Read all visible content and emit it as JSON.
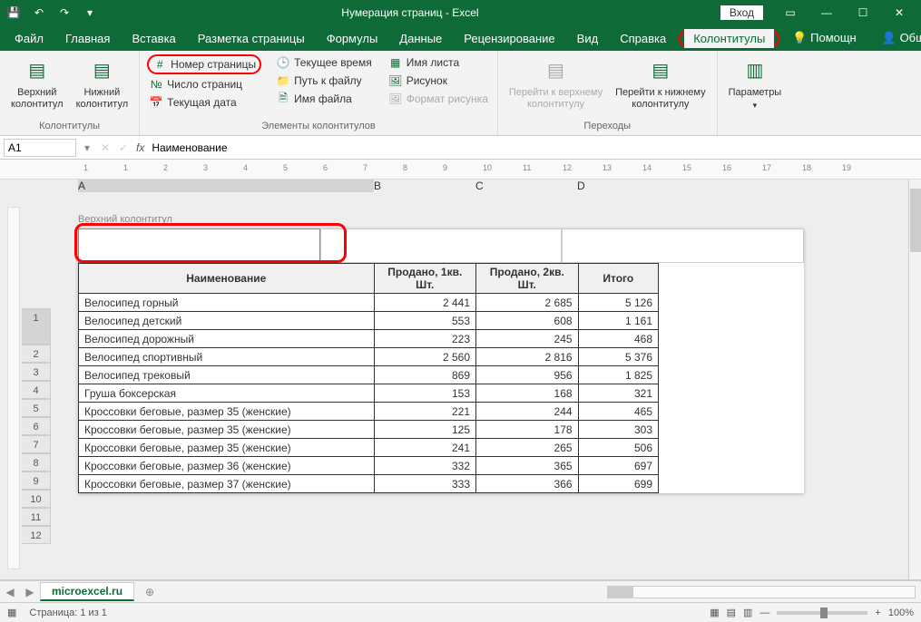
{
  "titlebar": {
    "title": "Нумерация страниц - Excel",
    "login": "Вход"
  },
  "tabs": {
    "file": "Файл",
    "home": "Главная",
    "insert": "Вставка",
    "pagelayout": "Разметка страницы",
    "formulas": "Формулы",
    "data": "Данные",
    "review": "Рецензирование",
    "view": "Вид",
    "help": "Справка",
    "headfoot": "Колонтитулы",
    "tell": "Помощн",
    "share": "Общий доступ"
  },
  "ribbon": {
    "g1": {
      "label": "Колонтитулы",
      "top": "Верхний\nколонтитул",
      "bottom": "Нижний\nколонтитул"
    },
    "g2": {
      "label": "Элементы колонтитулов",
      "pagenum": "Номер страницы",
      "pagecount": "Число страниц",
      "curdate": "Текущая дата",
      "curtime": "Текущее время",
      "filepath": "Путь к файлу",
      "filename": "Имя файла",
      "sheetname": "Имя листа",
      "picture": "Рисунок",
      "fmtpicture": "Формат рисунка"
    },
    "g3": {
      "label": "Переходы",
      "gotop": "Перейти к верхнему\nколонтитулу",
      "gobottom": "Перейти к нижнему\nколонтитулу"
    },
    "g4": {
      "label": "",
      "options": "Параметры"
    }
  },
  "formula": {
    "cellref": "A1",
    "value": "Наименование"
  },
  "colheads": {
    "A": "A",
    "B": "B",
    "C": "C",
    "D": "D"
  },
  "header_label": "Верхний колонтитул",
  "table": {
    "headers": {
      "name": "Наименование",
      "q1": "Продано, 1кв. Шт.",
      "q2": "Продано, 2кв. Шт.",
      "total": "Итого"
    },
    "rows": [
      {
        "name": "Велосипед горный",
        "q1": "2 441",
        "q2": "2 685",
        "total": "5 126"
      },
      {
        "name": "Велосипед детский",
        "q1": "553",
        "q2": "608",
        "total": "1 161"
      },
      {
        "name": "Велосипед дорожный",
        "q1": "223",
        "q2": "245",
        "total": "468"
      },
      {
        "name": "Велосипед спортивный",
        "q1": "2 560",
        "q2": "2 816",
        "total": "5 376"
      },
      {
        "name": "Велосипед трековый",
        "q1": "869",
        "q2": "956",
        "total": "1 825"
      },
      {
        "name": "Груша боксерская",
        "q1": "153",
        "q2": "168",
        "total": "321"
      },
      {
        "name": "Кроссовки беговые, размер 35 (женские)",
        "q1": "221",
        "q2": "244",
        "total": "465"
      },
      {
        "name": "Кроссовки беговые, размер 35 (женские)",
        "q1": "125",
        "q2": "178",
        "total": "303"
      },
      {
        "name": "Кроссовки беговые, размер 35 (женские)",
        "q1": "241",
        "q2": "265",
        "total": "506"
      },
      {
        "name": "Кроссовки беговые, размер 36 (женские)",
        "q1": "332",
        "q2": "365",
        "total": "697"
      },
      {
        "name": "Кроссовки беговые, размер 37 (женские)",
        "q1": "333",
        "q2": "366",
        "total": "699"
      }
    ]
  },
  "sheettab": "microexcel.ru",
  "status": {
    "page": "Страница: 1 из 1",
    "zoom": "100%"
  },
  "ruler_ticks": [
    "1",
    "1",
    "2",
    "3",
    "4",
    "5",
    "6",
    "7",
    "8",
    "9",
    "10",
    "11",
    "12",
    "13",
    "14",
    "15",
    "16",
    "17",
    "18",
    "19"
  ]
}
